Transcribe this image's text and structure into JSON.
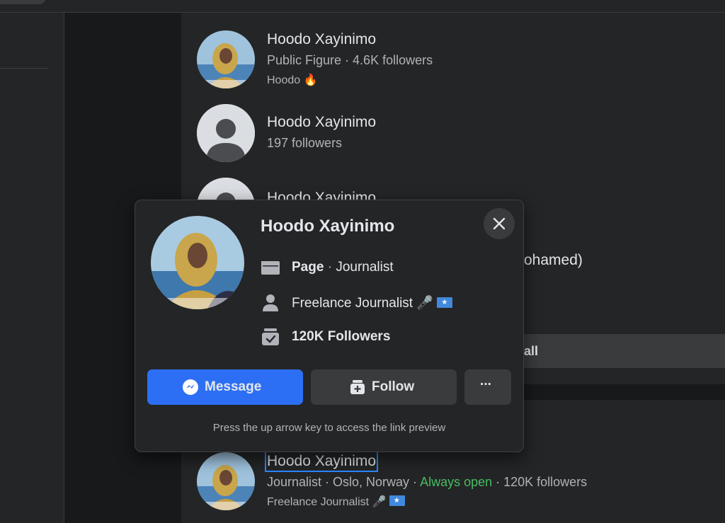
{
  "results": [
    {
      "name": "Hoodo Xayinimo",
      "meta": "Public Figure · 4.6K followers",
      "sub_text": "Hoodo",
      "sub_emoji": "🔥",
      "avatar": "profile-photo"
    },
    {
      "name": "Hoodo Xayinimo",
      "meta": "197 followers",
      "avatar": "default-avatar"
    },
    {
      "peek_name": "Hoodo Xayinimo",
      "peek_text": "ohamed)",
      "avatar": "default-avatar"
    },
    {
      "name": "Hoodo Xayinimo",
      "meta_prefix": "Journalist · Oslo, Norway · ",
      "meta_status": "Always open",
      "meta_suffix": " · 120K followers",
      "sub_text": "Freelance Journalist",
      "sub_emoji": "🎤",
      "avatar": "profile-photo"
    }
  ],
  "see_all_label": "all",
  "hover_card": {
    "name": "Hoodo Xayinimo",
    "type_label": "Page",
    "type_sep": " · ",
    "category": "Journalist",
    "bio": "Freelance Journalist",
    "bio_emoji": "🎤",
    "followers": "120K Followers",
    "message_label": "Message",
    "follow_label": "Follow",
    "more_label": "···",
    "hint": "Press the up arrow key to access the link preview",
    "close_icon": "close-icon"
  },
  "colors": {
    "accent": "#2d6ff4",
    "status_open": "#45bd62",
    "background": "#18191a",
    "card": "#242526"
  }
}
